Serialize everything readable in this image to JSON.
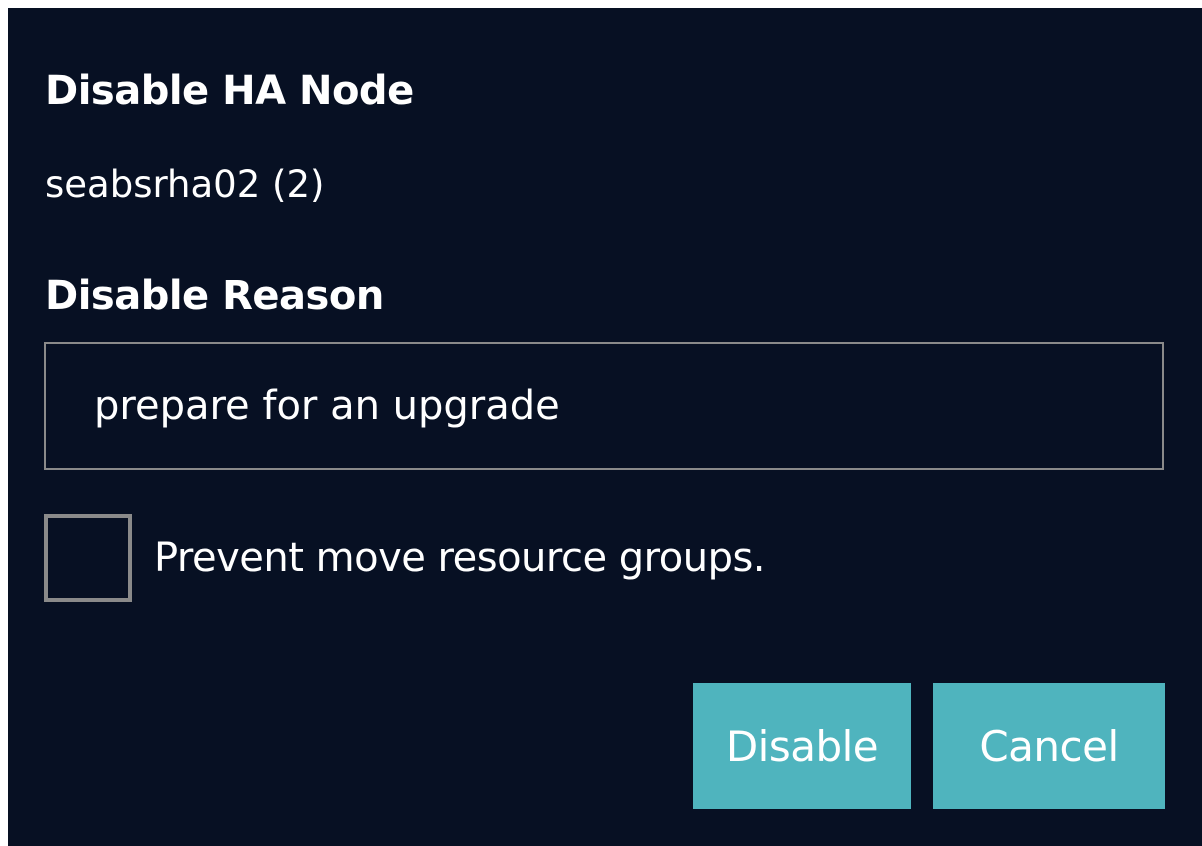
{
  "dialog": {
    "title": "Disable HA Node",
    "node_name": "seabsrha02 (2)",
    "reason_label": "Disable Reason",
    "reason_value": "prepare for an upgrade",
    "prevent_move_label": "Prevent move resource groups.",
    "prevent_move_checked": false,
    "disable_label": "Disable",
    "cancel_label": "Cancel"
  },
  "colors": {
    "background": "#071023",
    "button": "#4fb4be",
    "border": "#8a8a8a",
    "text": "#ffffff"
  }
}
